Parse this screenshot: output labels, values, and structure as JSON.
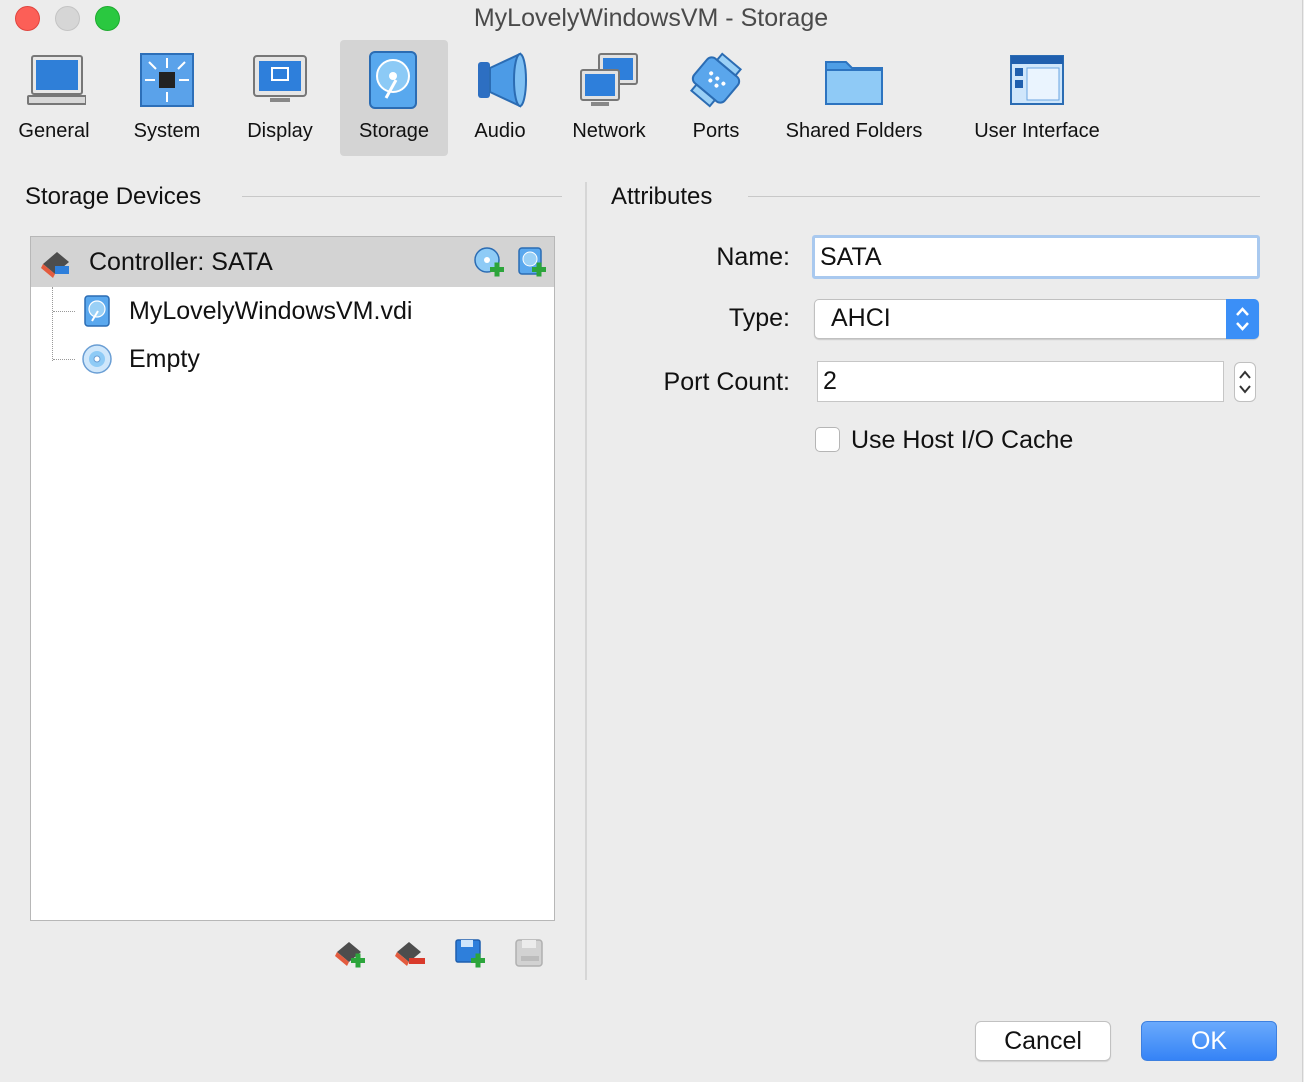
{
  "window": {
    "title": "MyLovelyWindowsVM - Storage"
  },
  "toolbar": {
    "items": [
      {
        "label": "General",
        "icon": "general-icon"
      },
      {
        "label": "System",
        "icon": "system-chip-icon"
      },
      {
        "label": "Display",
        "icon": "display-monitor-icon"
      },
      {
        "label": "Storage",
        "icon": "storage-disk-icon",
        "active": true
      },
      {
        "label": "Audio",
        "icon": "speaker-icon"
      },
      {
        "label": "Network",
        "icon": "network-icon"
      },
      {
        "label": "Ports",
        "icon": "serial-port-icon"
      },
      {
        "label": "Shared Folders",
        "icon": "folder-icon"
      },
      {
        "label": "User Interface",
        "icon": "user-interface-icon"
      }
    ]
  },
  "storage": {
    "title": "Storage Devices",
    "controller": {
      "label": "Controller: SATA",
      "icon": "sata-controller-icon"
    },
    "devices": [
      {
        "label": "MyLovelyWindowsVM.vdi",
        "icon": "hard-disk-icon"
      },
      {
        "label": "Empty",
        "icon": "optical-disc-icon"
      }
    ]
  },
  "attributes": {
    "title": "Attributes",
    "name_label": "Name:",
    "name_value": "SATA",
    "type_label": "Type:",
    "type_value": "AHCI",
    "port_count_label": "Port Count:",
    "port_count_value": "2",
    "host_cache_label": "Use Host I/O Cache",
    "host_cache_checked": false
  },
  "buttons": {
    "cancel": "Cancel",
    "ok": "OK"
  },
  "colors": {
    "accent": "#3b8ff7",
    "selection_row": "#d3d3d3",
    "active_tab": "#d4d4d4"
  }
}
